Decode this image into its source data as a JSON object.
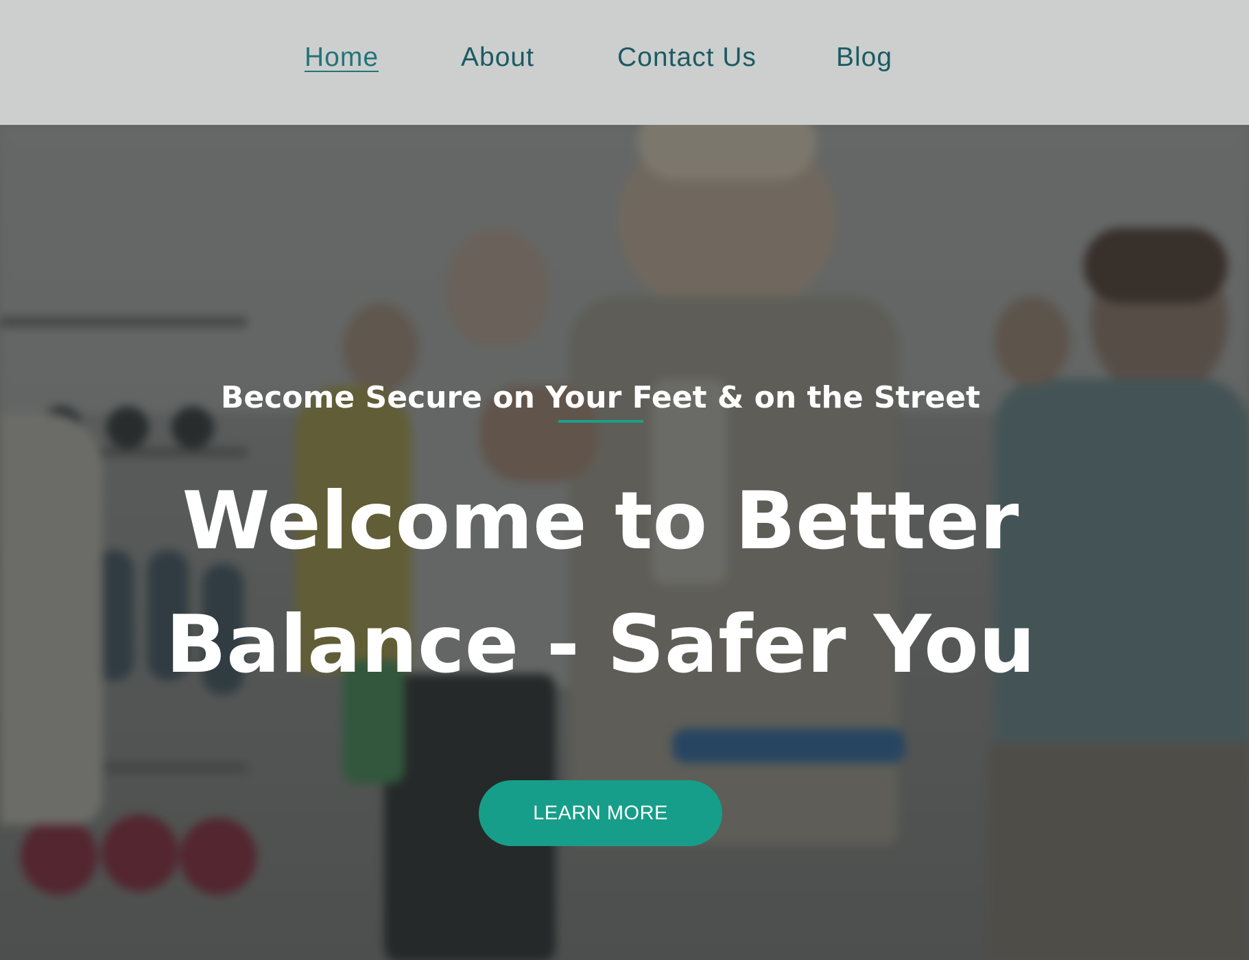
{
  "nav": {
    "items": [
      {
        "label": "Home",
        "active": true
      },
      {
        "label": "About",
        "active": false
      },
      {
        "label": "Contact Us",
        "active": false
      },
      {
        "label": "Blog",
        "active": false
      }
    ]
  },
  "hero": {
    "tagline": "Become Secure on Your Feet & on the Street",
    "headline_line1": "Welcome to Better",
    "headline_line2": "Balance - Safer You",
    "cta_label": "LEARN MORE",
    "background_image": "seniors-exercising-photo"
  },
  "colors": {
    "nav_background": "#cccfce",
    "nav_text": "#1c5a63",
    "accent": "#179e8a",
    "hero_text": "#ffffff"
  }
}
